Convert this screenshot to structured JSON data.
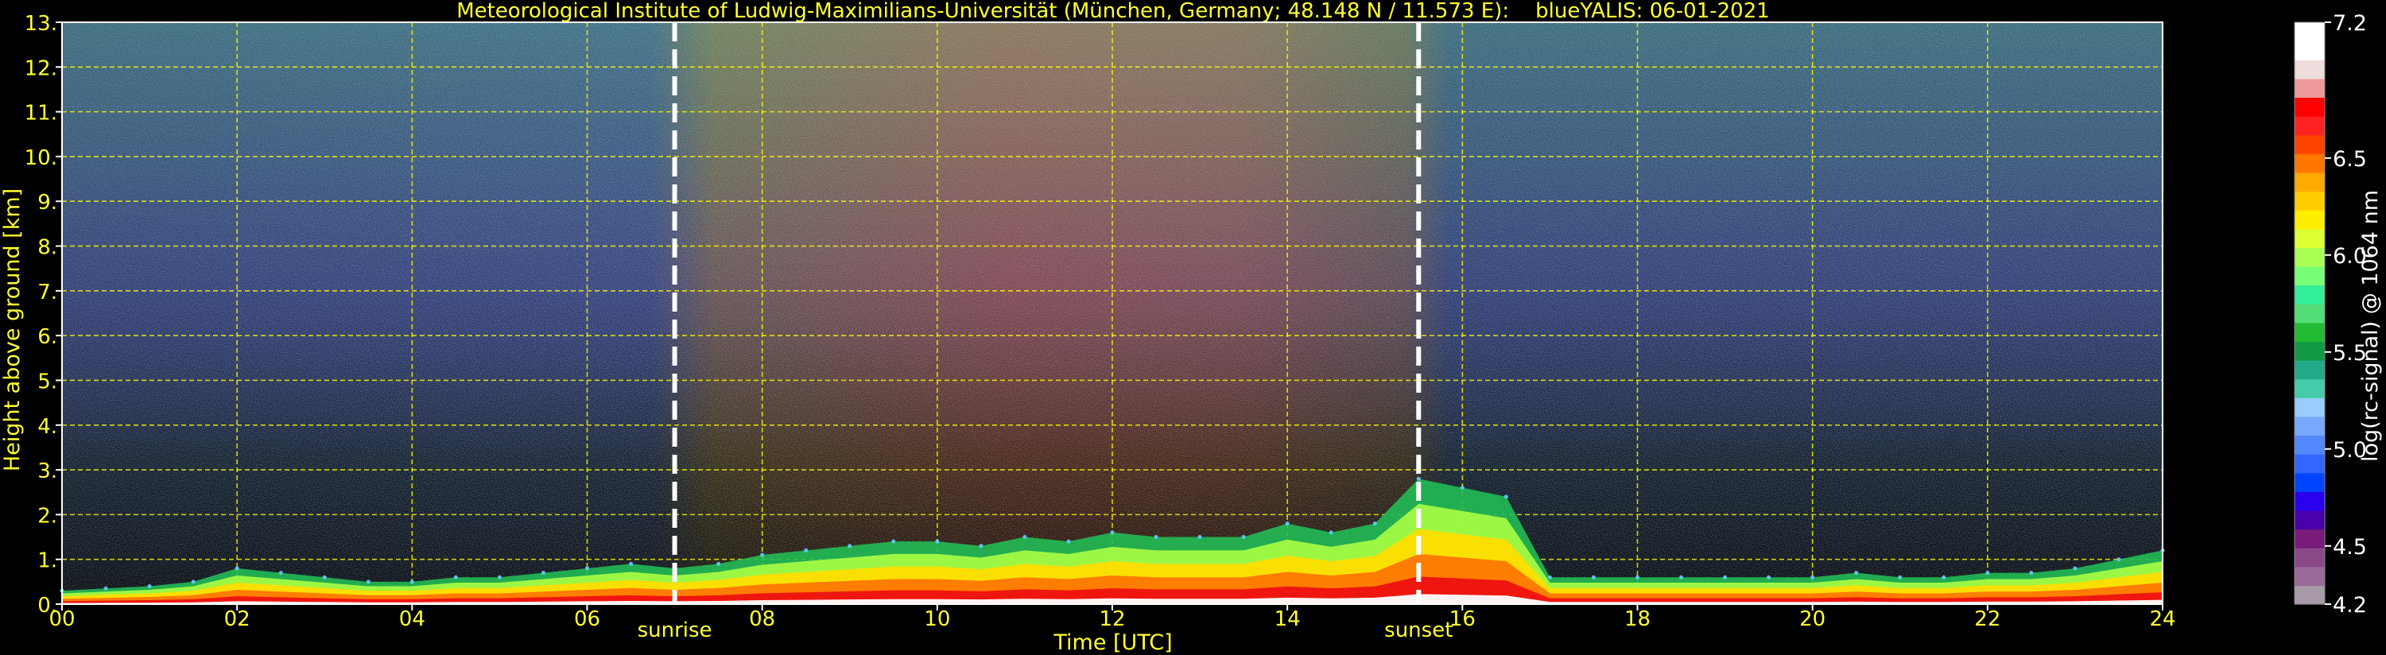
{
  "chart_data": {
    "type": "heatmap",
    "title": "Meteorological Institute of Ludwig-Maximilians-Universität (München, Germany; 48.148 N / 11.573 E):    blueYALIS: 06-01-2021",
    "xlabel": "Time [UTC]",
    "ylabel": "Height above ground [km]",
    "xlim": [
      0,
      24
    ],
    "ylim": [
      0,
      13
    ],
    "x_ticks": [
      "00",
      "02",
      "04",
      "06",
      "08",
      "10",
      "12",
      "14",
      "16",
      "18",
      "20",
      "22",
      "24"
    ],
    "y_ticks": [
      "0.",
      "1.",
      "2.",
      "3.",
      "4.",
      "5.",
      "6.",
      "7.",
      "8.",
      "9.",
      "10.",
      "11.",
      "12.",
      "13."
    ],
    "grid": true,
    "annotations": [
      {
        "label": "sunrise",
        "x": 7.0
      },
      {
        "label": "sunset",
        "x": 15.5
      }
    ],
    "colorbar": {
      "label": "log(rc-signal) @ 1064 nm",
      "range": [
        4.2,
        7.2
      ],
      "ticks": [
        "4.2",
        "4.5",
        "5.0",
        "5.5",
        "6.0",
        "6.5",
        "7.2"
      ],
      "colors": [
        "#a89aa8",
        "#9a6a9a",
        "#8a4a8a",
        "#7a1a7a",
        "#4a00aa",
        "#2a00ee",
        "#0044ff",
        "#3366ff",
        "#5588ff",
        "#77aaff",
        "#99ccff",
        "#44ccaa",
        "#22aa88",
        "#119944",
        "#22bb33",
        "#55dd77",
        "#33ee99",
        "#77ff77",
        "#aaff55",
        "#ddff33",
        "#ffee00",
        "#ffcc00",
        "#ffaa00",
        "#ff7700",
        "#ff4400",
        "#ff2222",
        "#ff0000",
        "#ee9999",
        "#eedddd",
        "#ffffff",
        "#ffffff"
      ]
    },
    "series": [
      {
        "x": [
          0,
          0.5,
          1,
          1.5,
          2,
          2.5,
          3,
          3.5,
          4,
          4.5,
          5,
          5.5,
          6,
          6.5,
          7,
          7.5,
          8,
          8.5,
          9,
          9.5,
          10,
          10.5,
          11,
          11.5,
          12,
          12.5,
          13,
          13.5,
          14,
          14.5,
          15,
          15.5,
          16,
          16.5,
          17,
          17.5,
          18,
          18.5,
          19,
          19.5,
          20,
          20.5,
          21,
          21.5,
          22,
          22.5,
          23,
          23.5,
          24
        ],
        "y": [
          0.3,
          0.35,
          0.4,
          0.5,
          0.8,
          0.7,
          0.6,
          0.5,
          0.5,
          0.6,
          0.6,
          0.7,
          0.8,
          0.9,
          0.8,
          0.9,
          1.1,
          1.2,
          1.3,
          1.4,
          1.4,
          1.3,
          1.5,
          1.4,
          1.6,
          1.5,
          1.5,
          1.5,
          1.8,
          1.6,
          1.8,
          2.8,
          2.6,
          2.4,
          0.6,
          0.6,
          0.6,
          0.6,
          0.6,
          0.6,
          0.6,
          0.7,
          0.6,
          0.6,
          0.7,
          0.7,
          0.8,
          1.0,
          1.2
        ]
      }
    ]
  }
}
